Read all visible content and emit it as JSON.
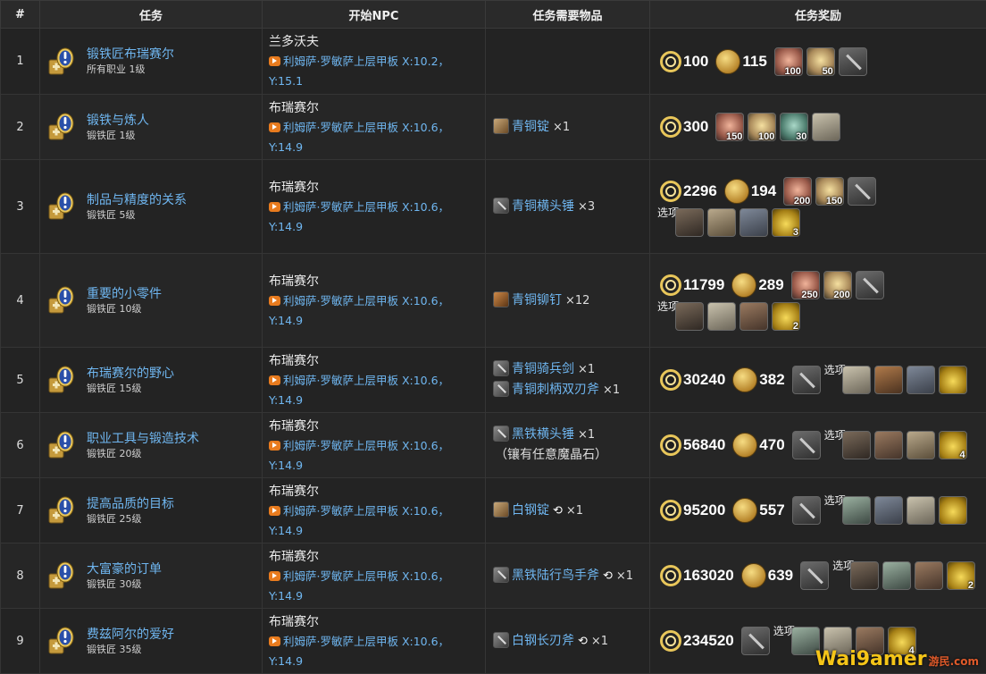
{
  "headers": [
    "#",
    "任务",
    "开始NPC",
    "任务需要物品",
    "任务奖励"
  ],
  "option_label": "选项",
  "quests": [
    {
      "num": "1",
      "name": "锻铁匠布瑞赛尔",
      "sub": "所有职业 1级",
      "npc": "兰多沃夫",
      "loc": "利姆萨·罗敏萨上层甲板 X:10.2，Y:15.1",
      "items": [],
      "note": "",
      "xp": "100",
      "gil": "115",
      "rewards": [
        {
          "type": "fire",
          "count": "100"
        },
        {
          "type": "light",
          "count": "50"
        },
        {
          "type": "tool",
          "count": ""
        }
      ],
      "options": []
    },
    {
      "num": "2",
      "name": "锻铁与炼人",
      "sub": "锻铁匠 1级",
      "npc": "布瑞赛尔",
      "loc": "利姆萨·罗敏萨上层甲板 X:10.6，Y:14.9",
      "items": [
        {
          "icon": "ingot",
          "name": "青铜锭",
          "qty": "×1",
          "hq": false
        }
      ],
      "note": "",
      "xp": "300",
      "gil": "",
      "rewards": [
        {
          "type": "fire",
          "count": "150"
        },
        {
          "type": "light",
          "count": "100"
        },
        {
          "type": "wind",
          "count": "30"
        },
        {
          "type": "cloth",
          "count": ""
        }
      ],
      "options": []
    },
    {
      "num": "3",
      "name": "制品与精度的关系",
      "sub": "锻铁匠 5级",
      "npc": "布瑞赛尔",
      "loc": "利姆萨·罗敏萨上层甲板 X:10.6，Y:14.9",
      "items": [
        {
          "icon": "tool",
          "name": "青铜横头锤",
          "qty": "×3",
          "hq": false
        }
      ],
      "note": "",
      "xp": "2296",
      "gil": "194",
      "rewards": [
        {
          "type": "fire",
          "count": "200"
        },
        {
          "type": "light",
          "count": "150"
        },
        {
          "type": "tool",
          "count": ""
        }
      ],
      "options": [
        {
          "type": "hat",
          "count": ""
        },
        {
          "type": "pants",
          "count": ""
        },
        {
          "type": "boots",
          "count": ""
        },
        {
          "type": "bag",
          "count": "3"
        }
      ]
    },
    {
      "num": "4",
      "name": "重要的小零件",
      "sub": "锻铁匠 10级",
      "npc": "布瑞赛尔",
      "loc": "利姆萨·罗敏萨上层甲板 X:10.6，Y:14.9",
      "items": [
        {
          "icon": "rivet",
          "name": "青铜铆钉",
          "qty": "×12",
          "hq": false
        }
      ],
      "note": "",
      "xp": "11799",
      "gil": "289",
      "rewards": [
        {
          "type": "fire",
          "count": "250"
        },
        {
          "type": "light",
          "count": "200"
        },
        {
          "type": "tool",
          "count": ""
        }
      ],
      "options": [
        {
          "type": "hat",
          "count": ""
        },
        {
          "type": "cloth",
          "count": ""
        },
        {
          "type": "glove",
          "count": ""
        },
        {
          "type": "bag",
          "count": "2"
        }
      ]
    },
    {
      "num": "5",
      "name": "布瑞赛尔的野心",
      "sub": "锻铁匠 15级",
      "npc": "布瑞赛尔",
      "loc": "利姆萨·罗敏萨上层甲板 X:10.6，Y:14.9",
      "items": [
        {
          "icon": "tool",
          "name": "青铜骑兵剑",
          "qty": "×1",
          "hq": false
        },
        {
          "icon": "tool",
          "name": "青铜刺柄双刃斧",
          "qty": "×1",
          "hq": false
        }
      ],
      "note": "",
      "xp": "30240",
      "gil": "382",
      "rewards": [
        {
          "type": "tool",
          "count": ""
        }
      ],
      "options": [
        {
          "type": "cloth",
          "count": ""
        },
        {
          "type": "belt",
          "count": ""
        },
        {
          "type": "boots",
          "count": ""
        },
        {
          "type": "bag",
          "count": ""
        }
      ]
    },
    {
      "num": "6",
      "name": "职业工具与锻造技术",
      "sub": "锻铁匠 20级",
      "npc": "布瑞赛尔",
      "loc": "利姆萨·罗敏萨上层甲板 X:10.6，Y:14.9",
      "items": [
        {
          "icon": "tool",
          "name": "黑铁横头锤",
          "qty": "×1",
          "hq": false
        }
      ],
      "note": "（镶有任意魔晶石）",
      "xp": "56840",
      "gil": "470",
      "rewards": [
        {
          "type": "tool",
          "count": ""
        }
      ],
      "options": [
        {
          "type": "hat",
          "count": ""
        },
        {
          "type": "glove",
          "count": ""
        },
        {
          "type": "pants",
          "count": ""
        },
        {
          "type": "bag",
          "count": "4"
        }
      ]
    },
    {
      "num": "7",
      "name": "提高品质的目标",
      "sub": "锻铁匠 25级",
      "npc": "布瑞赛尔",
      "loc": "利姆萨·罗敏萨上层甲板 X:10.6，Y:14.9",
      "items": [
        {
          "icon": "ingot",
          "name": "白钢锭",
          "qty": "×1",
          "hq": true
        }
      ],
      "note": "",
      "xp": "95200",
      "gil": "557",
      "rewards": [
        {
          "type": "tool",
          "count": ""
        }
      ],
      "options": [
        {
          "type": "band",
          "count": ""
        },
        {
          "type": "boots",
          "count": ""
        },
        {
          "type": "cloth",
          "count": ""
        },
        {
          "type": "bag",
          "count": ""
        }
      ]
    },
    {
      "num": "8",
      "name": "大富豪的订单",
      "sub": "锻铁匠 30级",
      "npc": "布瑞赛尔",
      "loc": "利姆萨·罗敏萨上层甲板 X:10.6，Y:14.9",
      "items": [
        {
          "icon": "tool",
          "name": "黑铁陆行鸟手斧",
          "qty": "×1",
          "hq": true
        }
      ],
      "note": "",
      "xp": "163020",
      "gil": "639",
      "rewards": [
        {
          "type": "tool",
          "count": ""
        }
      ],
      "options": [
        {
          "type": "hat",
          "count": ""
        },
        {
          "type": "band",
          "count": ""
        },
        {
          "type": "glove",
          "count": ""
        },
        {
          "type": "bag",
          "count": "2"
        }
      ]
    },
    {
      "num": "9",
      "name": "费兹阿尔的爱好",
      "sub": "锻铁匠 35级",
      "npc": "布瑞赛尔",
      "loc": "利姆萨·罗敏萨上层甲板 X:10.6，Y:14.9",
      "items": [
        {
          "icon": "tool",
          "name": "白钢长刃斧",
          "qty": "×1",
          "hq": true
        }
      ],
      "note": "",
      "xp": "234520",
      "gil": "",
      "rewards": [
        {
          "type": "tool",
          "count": ""
        }
      ],
      "options": [
        {
          "type": "band",
          "count": ""
        },
        {
          "type": "cloth",
          "count": ""
        },
        {
          "type": "glove",
          "count": ""
        },
        {
          "type": "bag",
          "count": "4"
        }
      ]
    }
  ],
  "watermark": {
    "main": "Wai9amer",
    "sub": "游民.com"
  }
}
